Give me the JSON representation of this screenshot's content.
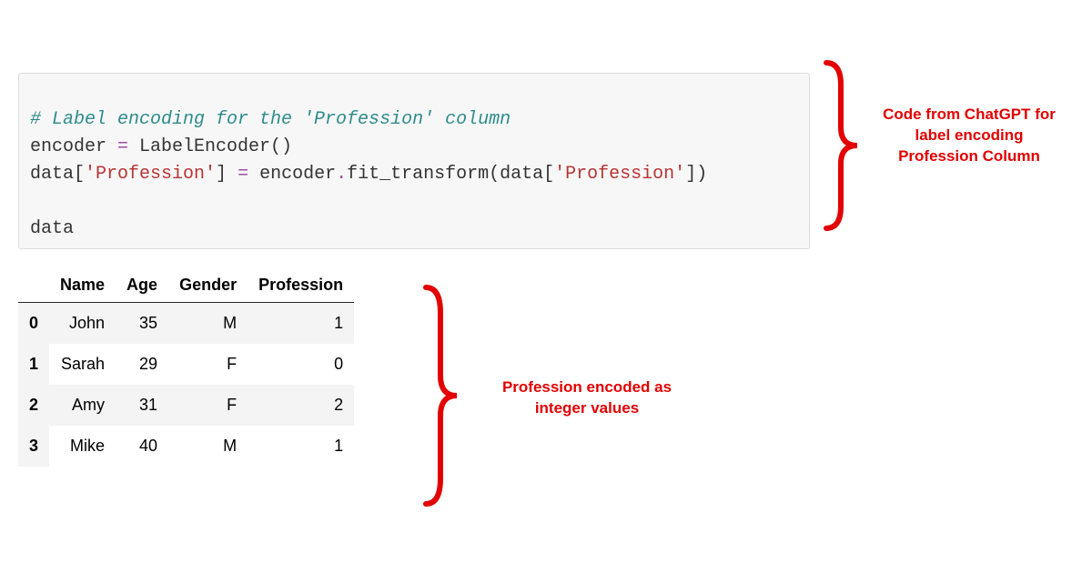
{
  "code": {
    "comment": "# Label encoding for the 'Profession' column",
    "line2_a": "encoder ",
    "line2_op": "=",
    "line2_b": " LabelEncoder()",
    "line3_a": "data[",
    "line3_s1": "'Profession'",
    "line3_b": "] ",
    "line3_op": "=",
    "line3_c": " encoder",
    "line3_dot": ".",
    "line3_fn": "fit_transform(data[",
    "line3_s2": "'Profession'",
    "line3_end": "])",
    "line5": "data"
  },
  "annotations": {
    "right": "Code from ChatGPT for label encoding Profession Column",
    "bottom": "Profession encoded as integer values"
  },
  "chart_data": {
    "type": "table",
    "columns": [
      "Name",
      "Age",
      "Gender",
      "Profession"
    ],
    "index": [
      "0",
      "1",
      "2",
      "3"
    ],
    "rows": [
      {
        "name": "John",
        "age": 35,
        "gender": "M",
        "profession": 1
      },
      {
        "name": "Sarah",
        "age": 29,
        "gender": "F",
        "profession": 0
      },
      {
        "name": "Amy",
        "age": 31,
        "gender": "F",
        "profession": 2
      },
      {
        "name": "Mike",
        "age": 40,
        "gender": "M",
        "profession": 1
      }
    ]
  }
}
